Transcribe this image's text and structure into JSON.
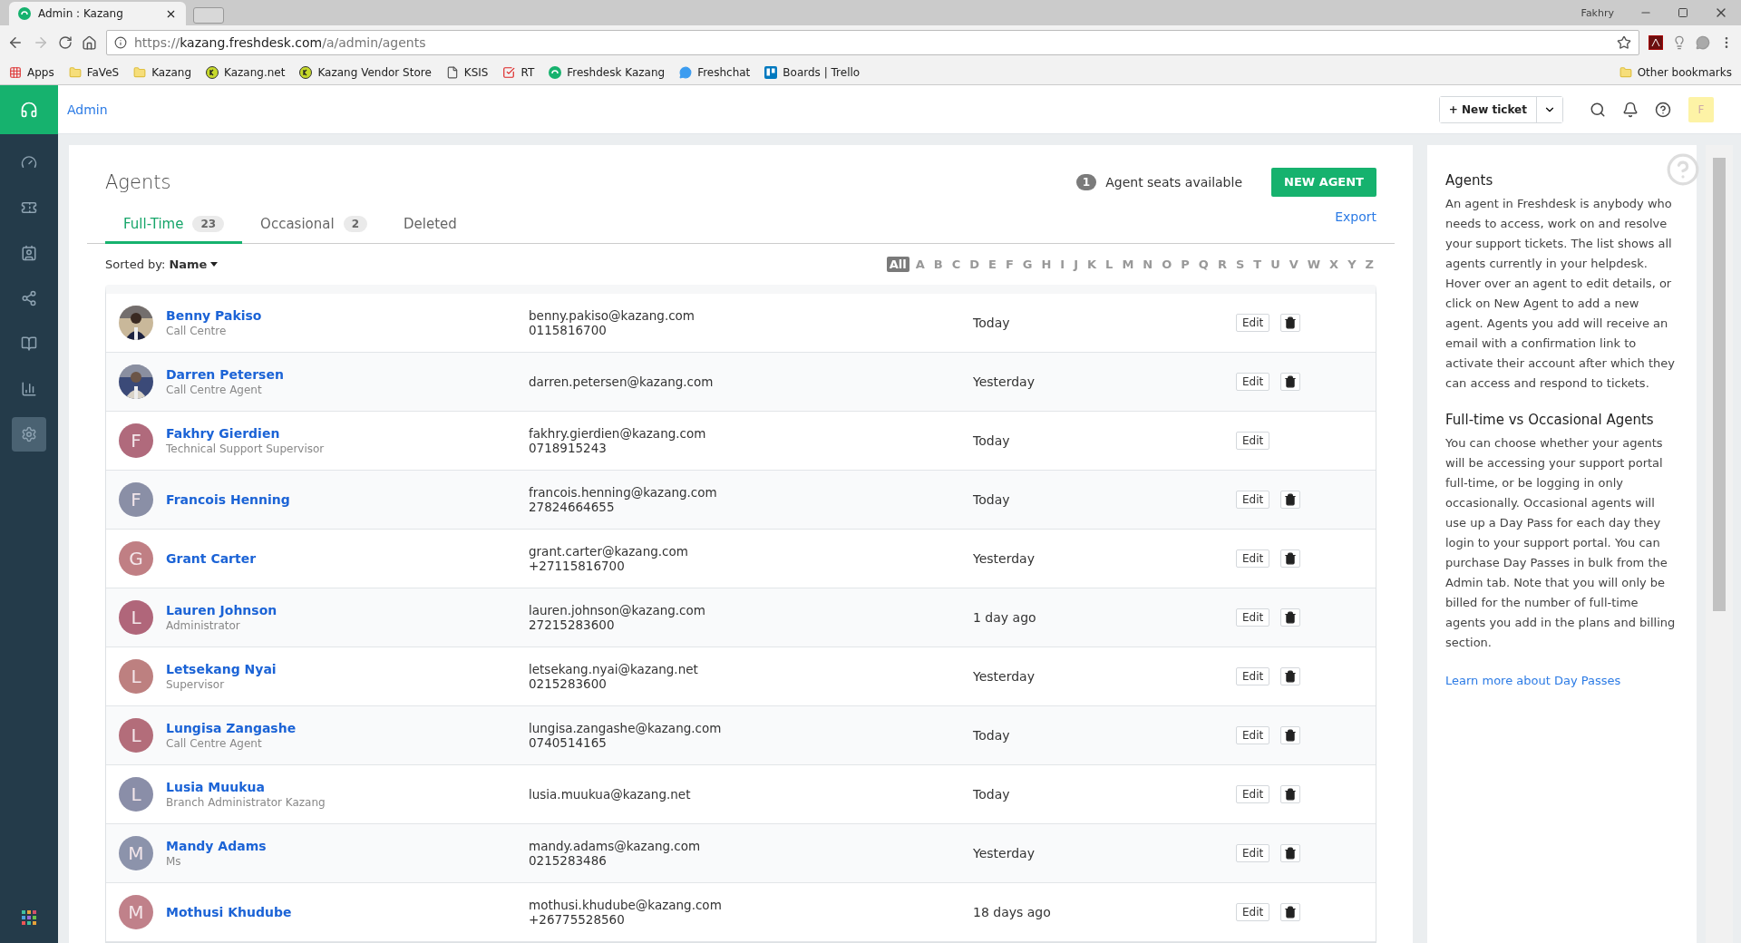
{
  "browser": {
    "tab_title": "Admin : Kazang",
    "user": "Fakhry",
    "url_prefix": "https://",
    "url_host": "kazang.freshdesk.com",
    "url_path": "/a/admin/agents",
    "bookmarks": [
      {
        "label": "Apps",
        "kind": "apps"
      },
      {
        "label": "FaVeS",
        "kind": "folder"
      },
      {
        "label": "Kazang",
        "kind": "folder"
      },
      {
        "label": "Kazang.net",
        "kind": "kazang"
      },
      {
        "label": "Kazang Vendor Store",
        "kind": "kazang"
      },
      {
        "label": "KSIS",
        "kind": "page"
      },
      {
        "label": "RT",
        "kind": "check"
      },
      {
        "label": "Freshdesk Kazang",
        "kind": "freshdesk"
      },
      {
        "label": "Freshchat",
        "kind": "chat"
      },
      {
        "label": "Boards | Trello",
        "kind": "trello"
      }
    ],
    "other_bookmarks": "Other bookmarks"
  },
  "header": {
    "title": "Admin",
    "new_ticket": "+ New ticket",
    "avatar": "F"
  },
  "sidebar": {
    "items": [
      {
        "kind": "dashboard",
        "selected": false
      },
      {
        "kind": "tickets",
        "selected": false
      },
      {
        "kind": "contacts",
        "selected": false
      },
      {
        "kind": "social",
        "selected": false
      },
      {
        "kind": "solutions",
        "selected": false
      },
      {
        "kind": "reports",
        "selected": false
      },
      {
        "kind": "admin",
        "selected": true
      }
    ]
  },
  "page": {
    "title": "Agents",
    "seats_count": "1",
    "seats_label": "Agent seats available",
    "new_agent": "NEW AGENT",
    "tabs": [
      {
        "label": "Full-Time",
        "count": "23",
        "selected": true
      },
      {
        "label": "Occasional",
        "count": "2",
        "selected": false
      },
      {
        "label": "Deleted",
        "selected": false
      }
    ],
    "export": "Export",
    "sorted_label": "Sorted by:",
    "sorted_value": "Name",
    "letters": [
      {
        "label": "All",
        "selected": true
      },
      {
        "label": "A",
        "selected": false
      },
      {
        "label": "B",
        "selected": false
      },
      {
        "label": "C",
        "selected": false
      },
      {
        "label": "D",
        "selected": false
      },
      {
        "label": "E",
        "selected": false
      },
      {
        "label": "F",
        "selected": false
      },
      {
        "label": "G",
        "selected": false
      },
      {
        "label": "H",
        "selected": false
      },
      {
        "label": "I",
        "selected": false
      },
      {
        "label": "J",
        "selected": false
      },
      {
        "label": "K",
        "selected": false
      },
      {
        "label": "L",
        "selected": false
      },
      {
        "label": "M",
        "selected": false
      },
      {
        "label": "N",
        "selected": false
      },
      {
        "label": "O",
        "selected": false
      },
      {
        "label": "P",
        "selected": false
      },
      {
        "label": "Q",
        "selected": false
      },
      {
        "label": "R",
        "selected": false
      },
      {
        "label": "S",
        "selected": false
      },
      {
        "label": "T",
        "selected": false
      },
      {
        "label": "U",
        "selected": false
      },
      {
        "label": "V",
        "selected": false
      },
      {
        "label": "W",
        "selected": false
      },
      {
        "label": "X",
        "selected": false
      },
      {
        "label": "Y",
        "selected": false
      },
      {
        "label": "Z",
        "selected": false
      }
    ],
    "agents": [
      {
        "name": "Benny Pakiso",
        "role": "Call Centre",
        "email": "benny.pakiso@kazang.com",
        "phone": "0115816700",
        "last_seen": "Today",
        "edit": "Edit",
        "deletable": true
      },
      {
        "name": "Darren Petersen",
        "role": "Call Centre Agent",
        "email": "darren.petersen@kazang.com",
        "last_seen": "Yesterday",
        "edit": "Edit",
        "deletable": true
      },
      {
        "name": "Fakhry Gierdien",
        "role": "Technical Support Supervisor",
        "email": "fakhry.gierdien@kazang.com",
        "phone": "0718915243",
        "last_seen": "Today",
        "edit": "Edit",
        "deletable": false,
        "avatar": {
          "kind": "letter",
          "letter": "F",
          "color": "#b06a7c"
        }
      },
      {
        "name": "Francois Henning",
        "email": "francois.henning@kazang.com",
        "phone": "27824664655",
        "last_seen": "Today",
        "edit": "Edit",
        "deletable": true,
        "avatar": {
          "kind": "letter",
          "letter": "F",
          "color": "#8a8fa6"
        }
      },
      {
        "name": "Grant Carter",
        "email": "grant.carter@kazang.com",
        "phone": "+27115816700",
        "last_seen": "Yesterday",
        "edit": "Edit",
        "deletable": true,
        "avatar": {
          "kind": "letter",
          "letter": "G",
          "color": "#c07f84"
        }
      },
      {
        "name": "Lauren Johnson",
        "role": "Administrator",
        "email": "lauren.johnson@kazang.com",
        "phone": "27215283600",
        "last_seen": "1 day ago",
        "edit": "Edit",
        "deletable": true,
        "avatar": {
          "kind": "letter",
          "letter": "L",
          "color": "#b0667a"
        }
      },
      {
        "name": "Letsekang Nyai",
        "role": "Supervisor",
        "email": "letsekang.nyai@kazang.net",
        "phone": "0215283600",
        "last_seen": "Yesterday",
        "edit": "Edit",
        "deletable": true,
        "avatar": {
          "kind": "letter",
          "letter": "L",
          "color": "#bd8080"
        }
      },
      {
        "name": "Lungisa Zangashe",
        "role": "Call Centre Agent",
        "email": "lungisa.zangashe@kazang.com",
        "phone": "0740514165",
        "last_seen": "Today",
        "edit": "Edit",
        "deletable": true,
        "avatar": {
          "kind": "letter",
          "letter": "L",
          "color": "#b36d7a"
        }
      },
      {
        "name": "Lusia Muukua",
        "role": "Branch Administrator Kazang",
        "email": "lusia.muukua@kazang.net",
        "last_seen": "Today",
        "edit": "Edit",
        "deletable": true,
        "avatar": {
          "kind": "letter",
          "letter": "L",
          "color": "#8a8ea8"
        }
      },
      {
        "name": "Mandy Adams",
        "role": "Ms",
        "email": "mandy.adams@kazang.com",
        "phone": "0215283486",
        "last_seen": "Yesterday",
        "edit": "Edit",
        "deletable": true,
        "avatar": {
          "kind": "letter",
          "letter": "M",
          "color": "#8c93ab"
        }
      },
      {
        "name": "Mothusi Khudube",
        "email": "mothusi.khudube@kazang.com",
        "phone": "+26775528560",
        "last_seen": "18 days ago",
        "edit": "Edit",
        "deletable": true,
        "avatar": {
          "kind": "letter",
          "letter": "M",
          "color": "#c0818a"
        }
      }
    ]
  },
  "help": {
    "sections": [
      {
        "title": "Agents",
        "text": "An agent in Freshdesk is anybody who needs to access, work on and resolve your support tickets. The list shows all agents currently in your helpdesk. Hover over an agent to edit details, or click on New Agent to add a new agent. Agents you add will receive an email with a confirmation link to activate their account after which they can access and respond to tickets."
      },
      {
        "title": "Full-time vs Occasional Agents",
        "text": "You can choose whether your agents will be accessing your support portal full-time, or be logging in only occasionally. Occasional agents will use up a Day Pass for each day they login to your support portal. You can purchase Day Passes in bulk from the Admin tab. Note that you will only be billed for the number of full-time agents you add in the plans and billing section."
      }
    ],
    "link": "Learn more about Day Passes"
  }
}
